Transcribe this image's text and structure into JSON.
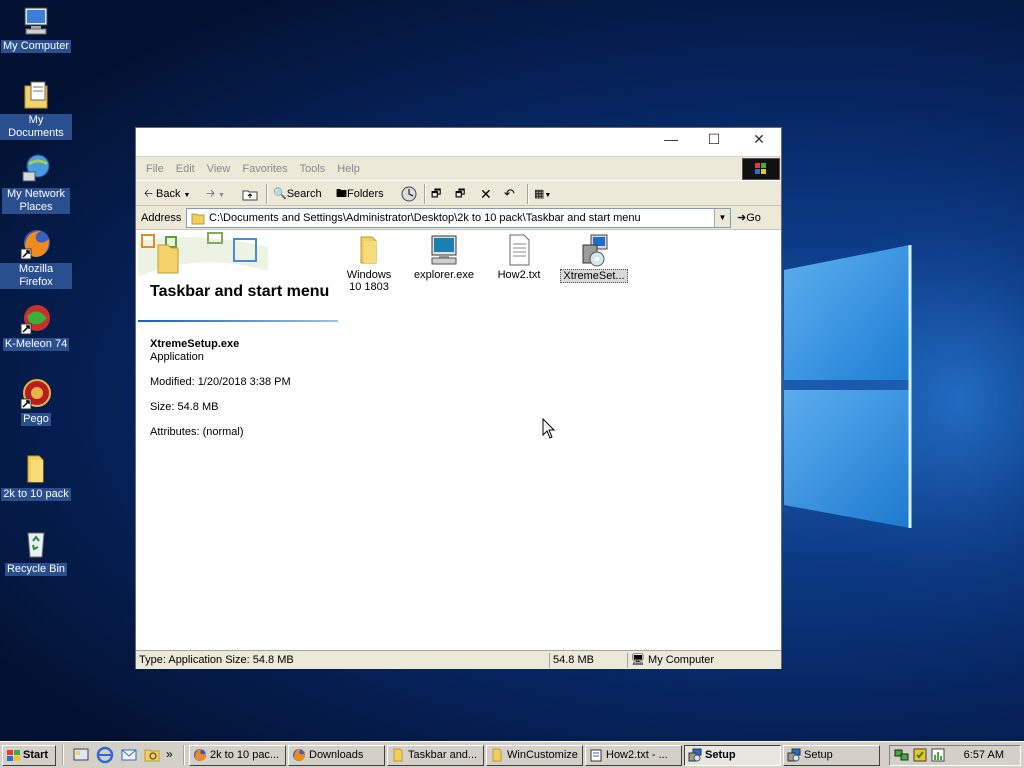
{
  "desktop": {
    "icons": [
      {
        "label": "My Computer",
        "icon": "computer-icon"
      },
      {
        "label": "My Documents",
        "icon": "documents-folder-icon"
      },
      {
        "label": "My Network Places",
        "icon": "network-places-icon"
      },
      {
        "label": "Mozilla Firefox",
        "icon": "firefox-icon"
      },
      {
        "label": "K-Meleon 74",
        "icon": "k-meleon-icon"
      },
      {
        "label": "Pego",
        "icon": "pego-icon"
      },
      {
        "label": "2k to 10 pack",
        "icon": "folder-icon"
      },
      {
        "label": "Recycle Bin",
        "icon": "recycle-bin-icon"
      }
    ]
  },
  "window": {
    "menu": [
      "File",
      "Edit",
      "View",
      "Favorites",
      "Tools",
      "Help"
    ],
    "toolbar": {
      "back": "Back",
      "search": "Search",
      "folders": "Folders"
    },
    "address": {
      "label": "Address",
      "path": "C:\\Documents and Settings\\Administrator\\Desktop\\2k to 10 pack\\Taskbar and start menu",
      "go": "Go"
    },
    "folder_title": "Taskbar and start menu",
    "details": {
      "name": "XtremeSetup.exe",
      "type": "Application",
      "modified": "Modified: 1/20/2018 3:38 PM",
      "size": "Size: 54.8 MB",
      "attributes": "Attributes: (normal)"
    },
    "files": [
      {
        "label": "Windows 10 1803",
        "icon": "folder-icon"
      },
      {
        "label": "explorer.exe",
        "icon": "computer-icon"
      },
      {
        "label": "How2.txt",
        "icon": "text-file-icon"
      },
      {
        "label": "XtremeSet...",
        "icon": "setup-icon",
        "selected": true
      }
    ],
    "status": {
      "info": "Type: Application Size: 54.8 MB",
      "size": "54.8 MB",
      "zone": "My Computer"
    }
  },
  "taskbar": {
    "start": "Start",
    "tasks": [
      {
        "label": "2k to 10 pac...",
        "icon": "firefox-icon"
      },
      {
        "label": "Downloads",
        "icon": "firefox-icon"
      },
      {
        "label": "Taskbar and...",
        "icon": "folder-icon"
      },
      {
        "label": "WinCustomize",
        "icon": "folder-icon"
      },
      {
        "label": "How2.txt - ...",
        "icon": "notepad-icon"
      },
      {
        "label": "Setup",
        "icon": "setup-icon",
        "active": true
      },
      {
        "label": "Setup",
        "icon": "setup-icon"
      }
    ],
    "clock": "6:57 AM"
  },
  "colors": {
    "desktop_bg": "#0c3b86",
    "window_chrome": "#ece9d8",
    "taskbar": "#d4d0c8",
    "selection": "#2a4f8f"
  }
}
